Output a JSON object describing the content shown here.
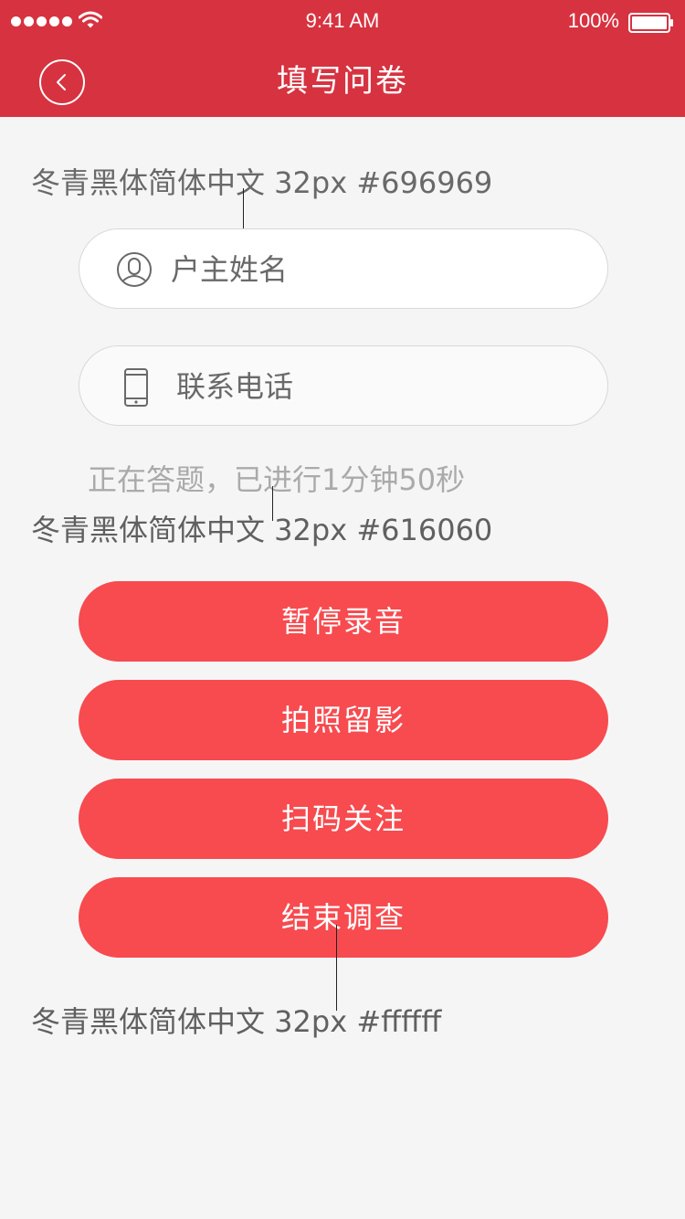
{
  "status_bar": {
    "time": "9:41 AM",
    "battery": "100%"
  },
  "header": {
    "title": "填写问卷"
  },
  "annotations": {
    "field_spec": "冬青黑体简体中文 32px #696969",
    "progress_spec": "冬青黑体简体中文 32px #616060",
    "button_spec": "冬青黑体简体中文 32px #ffffff"
  },
  "form": {
    "owner_name_label": "户主姓名",
    "phone_label": "联系电话"
  },
  "progress_text": "正在答题，已进行1分钟50秒",
  "buttons": {
    "pause_recording": "暂停录音",
    "take_photo": "拍照留影",
    "scan_follow": "扫码关注",
    "end_survey": "结束调查"
  },
  "colors": {
    "header_bg": "#d73240",
    "page_bg": "#f5f5f5",
    "button_bg": "#f74b4f",
    "field_text": "#696969",
    "progress_text": "#aaaaaa",
    "annotation_text": "#616060",
    "button_text": "#ffffff"
  },
  "icons": {
    "back": "chevron-left-icon",
    "user": "user-icon",
    "phone": "phone-icon",
    "wifi": "wifi-icon",
    "battery": "battery-icon"
  }
}
